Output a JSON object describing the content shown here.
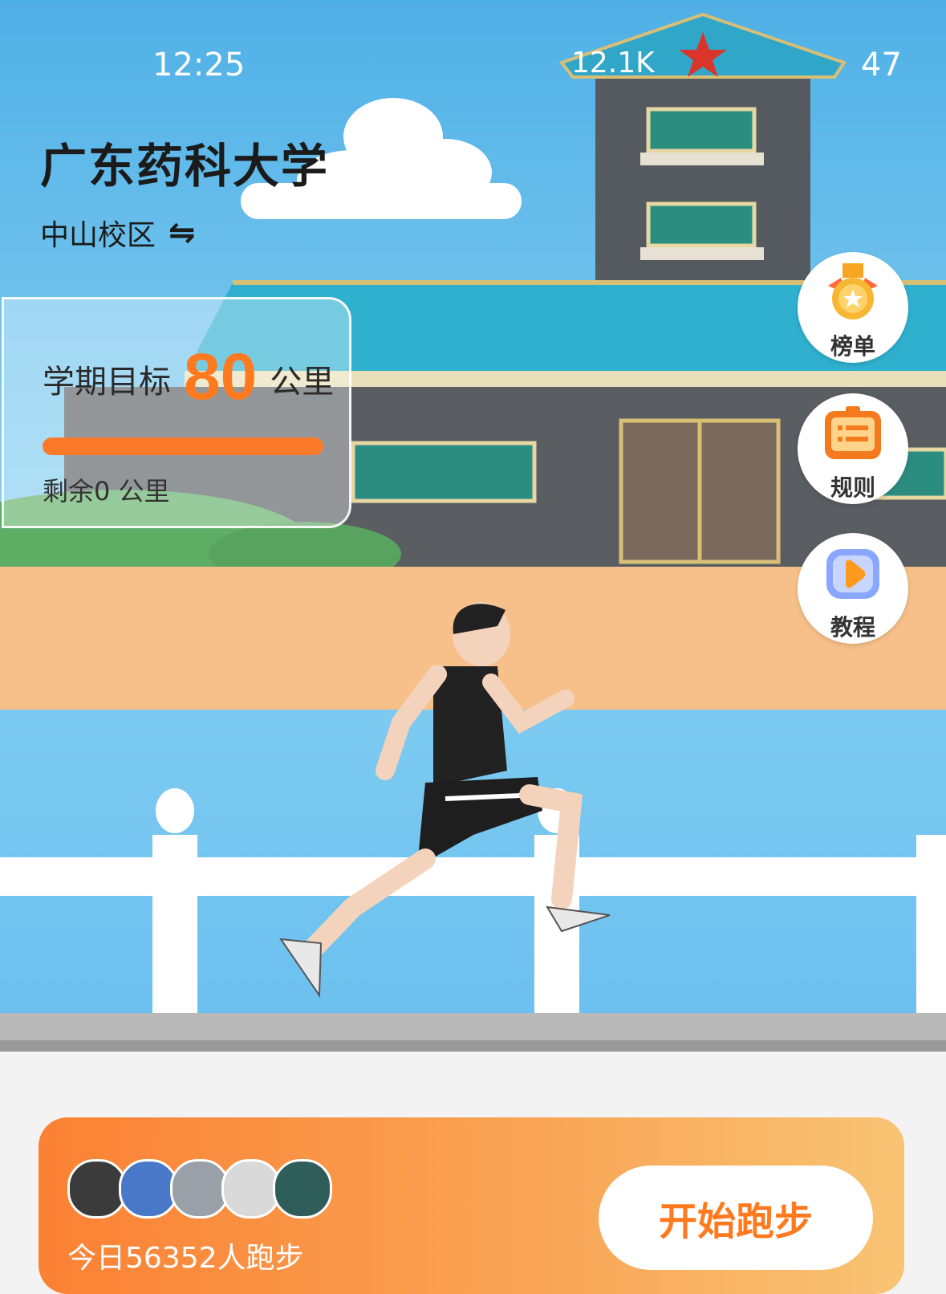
{
  "status_bar": {
    "time": "12:25",
    "network": "12.1K",
    "battery": "47"
  },
  "header": {
    "university": "广东药科大学",
    "campus": "中山校区",
    "switch_icon": "⇋"
  },
  "goal_card": {
    "label": "学期目标",
    "target": "80",
    "unit": "公里",
    "remaining": "剩余0 公里",
    "progress_percent": 100
  },
  "side_buttons": [
    {
      "label": "榜单",
      "icon": "medal-icon"
    },
    {
      "label": "规则",
      "icon": "rules-board-icon"
    },
    {
      "label": "教程",
      "icon": "play-video-icon"
    }
  ],
  "bottom_card": {
    "today_runners": "今日56352人跑步",
    "start_button": "开始跑步"
  },
  "colors": {
    "accent": "#ff7a1f",
    "sky": "#56b8ea",
    "track": "#f7c08a"
  }
}
